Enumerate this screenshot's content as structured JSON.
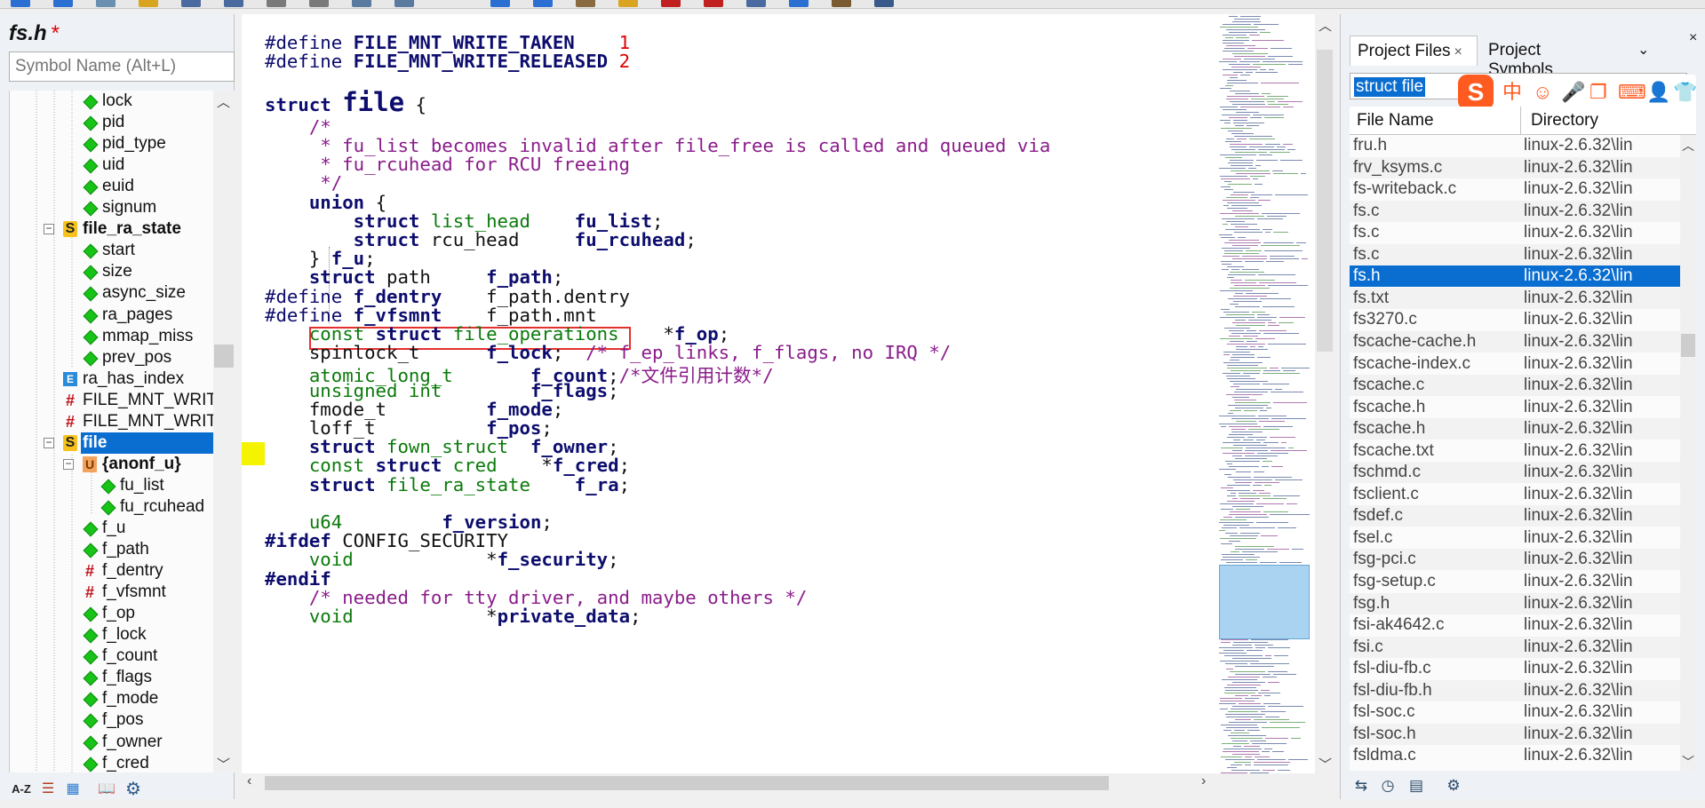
{
  "colors": {
    "keyword": "#0d0d6e",
    "number": "#e00000",
    "comment": "#8a1c8a",
    "type": "#0b7a0b",
    "selection": "#0a6ed1",
    "highlight_box": "#e53030",
    "gutter_marker": "#f4f400",
    "ime_brand": "#ff5a1f"
  },
  "toolbar": {
    "icons": [
      "back-icon",
      "forward-icon",
      "new-file-icon",
      "open-icon",
      "save-icon",
      "save-all-icon",
      "print-icon",
      "cut-icon",
      "copy-icon",
      "paste-icon",
      "undo-icon",
      "redo-icon",
      "find-icon",
      "replace-icon",
      "bookmark-icon",
      "jump-icon",
      "build-icon",
      "lookup-icon",
      "context-icon",
      "relation-icon"
    ]
  },
  "left_panel": {
    "file_title": "fs.h",
    "dirty_mark": "*",
    "search_placeholder": "Symbol Name (Alt+L)",
    "tree": [
      {
        "label": "lock",
        "icon": "var"
      },
      {
        "label": "pid",
        "icon": "var"
      },
      {
        "label": "pid_type",
        "icon": "var"
      },
      {
        "label": "uid",
        "icon": "var"
      },
      {
        "label": "euid",
        "icon": "var"
      },
      {
        "label": "signum",
        "icon": "var"
      },
      {
        "label": "file_ra_state",
        "icon": "struct",
        "bold": true,
        "expander": "−"
      },
      {
        "label": "start",
        "icon": "var"
      },
      {
        "label": "size",
        "icon": "var"
      },
      {
        "label": "async_size",
        "icon": "var"
      },
      {
        "label": "ra_pages",
        "icon": "var"
      },
      {
        "label": "mmap_miss",
        "icon": "var"
      },
      {
        "label": "prev_pos",
        "icon": "var"
      },
      {
        "label": "ra_has_index",
        "icon": "enum"
      },
      {
        "label": "FILE_MNT_WRIT",
        "icon": "hash"
      },
      {
        "label": "FILE_MNT_WRIT",
        "icon": "hash"
      },
      {
        "label": "file",
        "icon": "struct",
        "bold": true,
        "selected": true,
        "expander": "−"
      },
      {
        "label": "{anonf_u}",
        "icon": "union",
        "bold": true,
        "expander": "−"
      },
      {
        "label": "fu_list",
        "icon": "var"
      },
      {
        "label": "fu_rcuhead",
        "icon": "var"
      },
      {
        "label": "f_u",
        "icon": "var"
      },
      {
        "label": "f_path",
        "icon": "var"
      },
      {
        "label": "f_dentry",
        "icon": "hash"
      },
      {
        "label": "f_vfsmnt",
        "icon": "hash"
      },
      {
        "label": "f_op",
        "icon": "var"
      },
      {
        "label": "f_lock",
        "icon": "var"
      },
      {
        "label": "f_count",
        "icon": "var"
      },
      {
        "label": "f_flags",
        "icon": "var"
      },
      {
        "label": "f_mode",
        "icon": "var"
      },
      {
        "label": "f_pos",
        "icon": "var"
      },
      {
        "label": "f_owner",
        "icon": "var"
      },
      {
        "label": "f_cred",
        "icon": "var"
      }
    ],
    "bottom_icons": {
      "sort": "A-Z",
      "list": "☰",
      "category": "▦",
      "book": "📖",
      "settings": "⚙"
    }
  },
  "editor": {
    "lines": [
      [
        [
          "pp",
          "#define "
        ],
        [
          "fld",
          "FILE_MNT_WRITE_TAKEN"
        ],
        [
          "",
          "    "
        ],
        [
          "num",
          "1"
        ]
      ],
      [
        [
          "pp",
          "#define "
        ],
        [
          "fld",
          "FILE_MNT_WRITE_RELEASED"
        ],
        [
          "",
          " "
        ],
        [
          "num",
          "2"
        ]
      ],
      [],
      [
        [
          "kw",
          "struct "
        ],
        [
          "big",
          "file"
        ],
        [
          "",
          " {"
        ]
      ],
      [
        [
          "cm",
          "    /*"
        ]
      ],
      [
        [
          "cm",
          "     * fu_list becomes invalid after file_free is called and queued via"
        ]
      ],
      [
        [
          "cm",
          "     * fu_rcuhead for RCU freeing"
        ]
      ],
      [
        [
          "cm",
          "     */"
        ]
      ],
      [
        [
          "",
          "    "
        ],
        [
          "kw",
          "union"
        ],
        [
          "",
          " {"
        ]
      ],
      [
        [
          "",
          "        "
        ],
        [
          "kw",
          "struct "
        ],
        [
          "ty",
          "list_head"
        ],
        [
          "",
          "    "
        ],
        [
          "fld",
          "fu_list"
        ],
        [
          "",
          ";"
        ]
      ],
      [
        [
          "",
          "        "
        ],
        [
          "kw",
          "struct "
        ],
        [
          "",
          "rcu_head"
        ],
        [
          "",
          "     "
        ],
        [
          "fld",
          "fu_rcuhead"
        ],
        [
          "",
          ";"
        ]
      ],
      [
        [
          "",
          "    } "
        ],
        [
          "fld",
          "f_u"
        ],
        [
          "",
          ";"
        ]
      ],
      [
        [
          "",
          "    "
        ],
        [
          "kw",
          "struct "
        ],
        [
          "",
          "path"
        ],
        [
          "",
          "     "
        ],
        [
          "fld",
          "f_path"
        ],
        [
          "",
          ";"
        ]
      ],
      [
        [
          "pp",
          "#define "
        ],
        [
          "fld",
          "f_dentry"
        ],
        [
          "",
          "    f_path.dentry"
        ]
      ],
      [
        [
          "pp",
          "#define "
        ],
        [
          "fld",
          "f_vfsmnt"
        ],
        [
          "",
          "    f_path.mnt"
        ]
      ],
      [
        [
          "",
          "    "
        ],
        [
          "ty",
          "const "
        ],
        [
          "kw",
          "struct "
        ],
        [
          "ty",
          "file_operations"
        ],
        [
          "",
          "    *"
        ],
        [
          "fld",
          "f_op"
        ],
        [
          "",
          ";"
        ]
      ],
      [
        [
          "",
          "    spinlock_t      "
        ],
        [
          "fld",
          "f_lock"
        ],
        [
          "",
          ";  "
        ],
        [
          "cm",
          "/* f_ep_links, f_flags, no IRQ */"
        ]
      ],
      [
        [
          "",
          "    "
        ],
        [
          "ty",
          "atomic_long_t"
        ],
        [
          "",
          "       "
        ],
        [
          "fld",
          "f_count"
        ],
        [
          "",
          ";"
        ],
        [
          "cm",
          "/*文件引用计数*/"
        ]
      ],
      [
        [
          "",
          "    "
        ],
        [
          "ty",
          "unsigned int"
        ],
        [
          "",
          "        "
        ],
        [
          "fld",
          "f_flags"
        ],
        [
          "",
          ";"
        ]
      ],
      [
        [
          "",
          "    fmode_t         "
        ],
        [
          "fld",
          "f_mode"
        ],
        [
          "",
          ";"
        ]
      ],
      [
        [
          "",
          "    loff_t          "
        ],
        [
          "fld",
          "f_pos"
        ],
        [
          "",
          ";"
        ]
      ],
      [
        [
          "",
          "    "
        ],
        [
          "kw",
          "struct "
        ],
        [
          "ty",
          "fown_struct"
        ],
        [
          "",
          "  "
        ],
        [
          "fld",
          "f_owner"
        ],
        [
          "",
          ";"
        ]
      ],
      [
        [
          "",
          "    "
        ],
        [
          "ty",
          "const "
        ],
        [
          "kw",
          "struct "
        ],
        [
          "ty",
          "cred"
        ],
        [
          "",
          "    *"
        ],
        [
          "fld",
          "f_cred"
        ],
        [
          "",
          ";"
        ]
      ],
      [
        [
          "",
          "    "
        ],
        [
          "kw",
          "struct "
        ],
        [
          "ty",
          "file_ra_state"
        ],
        [
          "",
          "    "
        ],
        [
          "fld",
          "f_ra"
        ],
        [
          "",
          ";"
        ]
      ],
      [],
      [
        [
          "",
          "    "
        ],
        [
          "ty",
          "u64"
        ],
        [
          "",
          "         "
        ],
        [
          "fld",
          "f_version"
        ],
        [
          "",
          ";"
        ]
      ],
      [
        [
          "kw",
          "#ifdef "
        ],
        [
          "",
          "CONFIG_SECURITY"
        ]
      ],
      [
        [
          "",
          "    "
        ],
        [
          "ty",
          "void"
        ],
        [
          "",
          "            *"
        ],
        [
          "fld",
          "f_security"
        ],
        [
          "",
          ";"
        ]
      ],
      [
        [
          "kw",
          "#endif"
        ]
      ],
      [
        [
          "cm",
          "    /* needed for tty driver, and maybe others */"
        ]
      ],
      [
        [
          "",
          "    "
        ],
        [
          "ty",
          "void"
        ],
        [
          "",
          "            *"
        ],
        [
          "fld",
          "private_data"
        ],
        [
          "",
          ";"
        ]
      ]
    ]
  },
  "right_panel": {
    "tab_files": "Project Files",
    "tab_files_close": "×",
    "tab_symbols": "Project Symbols",
    "tab_dropdown": "⌄",
    "panel_close": "×",
    "search_value": "struct file",
    "ime": {
      "logo": "S",
      "lang": "中",
      "icons": [
        "☺",
        "🎤",
        "❐",
        "⌨",
        "👤",
        "👕"
      ]
    },
    "col_filename": "File Name",
    "col_directory": "Directory",
    "files": [
      {
        "name": "fru.h",
        "dir": "linux-2.6.32\\lin"
      },
      {
        "name": "frv_ksyms.c",
        "dir": "linux-2.6.32\\lin"
      },
      {
        "name": "fs-writeback.c",
        "dir": "linux-2.6.32\\lin"
      },
      {
        "name": "fs.c",
        "dir": "linux-2.6.32\\lin"
      },
      {
        "name": "fs.c",
        "dir": "linux-2.6.32\\lin"
      },
      {
        "name": "fs.c",
        "dir": "linux-2.6.32\\lin"
      },
      {
        "name": "fs.h",
        "dir": "linux-2.6.32\\lin",
        "selected": true
      },
      {
        "name": "fs.txt",
        "dir": "linux-2.6.32\\lin"
      },
      {
        "name": "fs3270.c",
        "dir": "linux-2.6.32\\lin"
      },
      {
        "name": "fscache-cache.h",
        "dir": "linux-2.6.32\\lin"
      },
      {
        "name": "fscache-index.c",
        "dir": "linux-2.6.32\\lin"
      },
      {
        "name": "fscache.c",
        "dir": "linux-2.6.32\\lin"
      },
      {
        "name": "fscache.h",
        "dir": "linux-2.6.32\\lin"
      },
      {
        "name": "fscache.h",
        "dir": "linux-2.6.32\\lin"
      },
      {
        "name": "fscache.txt",
        "dir": "linux-2.6.32\\lin"
      },
      {
        "name": "fschmd.c",
        "dir": "linux-2.6.32\\lin"
      },
      {
        "name": "fsclient.c",
        "dir": "linux-2.6.32\\lin"
      },
      {
        "name": "fsdef.c",
        "dir": "linux-2.6.32\\lin"
      },
      {
        "name": "fsel.c",
        "dir": "linux-2.6.32\\lin"
      },
      {
        "name": "fsg-pci.c",
        "dir": "linux-2.6.32\\lin"
      },
      {
        "name": "fsg-setup.c",
        "dir": "linux-2.6.32\\lin"
      },
      {
        "name": "fsg.h",
        "dir": "linux-2.6.32\\lin"
      },
      {
        "name": "fsi-ak4642.c",
        "dir": "linux-2.6.32\\lin"
      },
      {
        "name": "fsi.c",
        "dir": "linux-2.6.32\\lin"
      },
      {
        "name": "fsl-diu-fb.c",
        "dir": "linux-2.6.32\\lin"
      },
      {
        "name": "fsl-diu-fb.h",
        "dir": "linux-2.6.32\\lin"
      },
      {
        "name": "fsl-soc.c",
        "dir": "linux-2.6.32\\lin"
      },
      {
        "name": "fsl-soc.h",
        "dir": "linux-2.6.32\\lin"
      },
      {
        "name": "fsldma.c",
        "dir": "linux-2.6.32\\lin"
      }
    ],
    "bottom_icons": [
      "sync-icon",
      "history-icon",
      "list-icon",
      "settings-icon"
    ]
  }
}
